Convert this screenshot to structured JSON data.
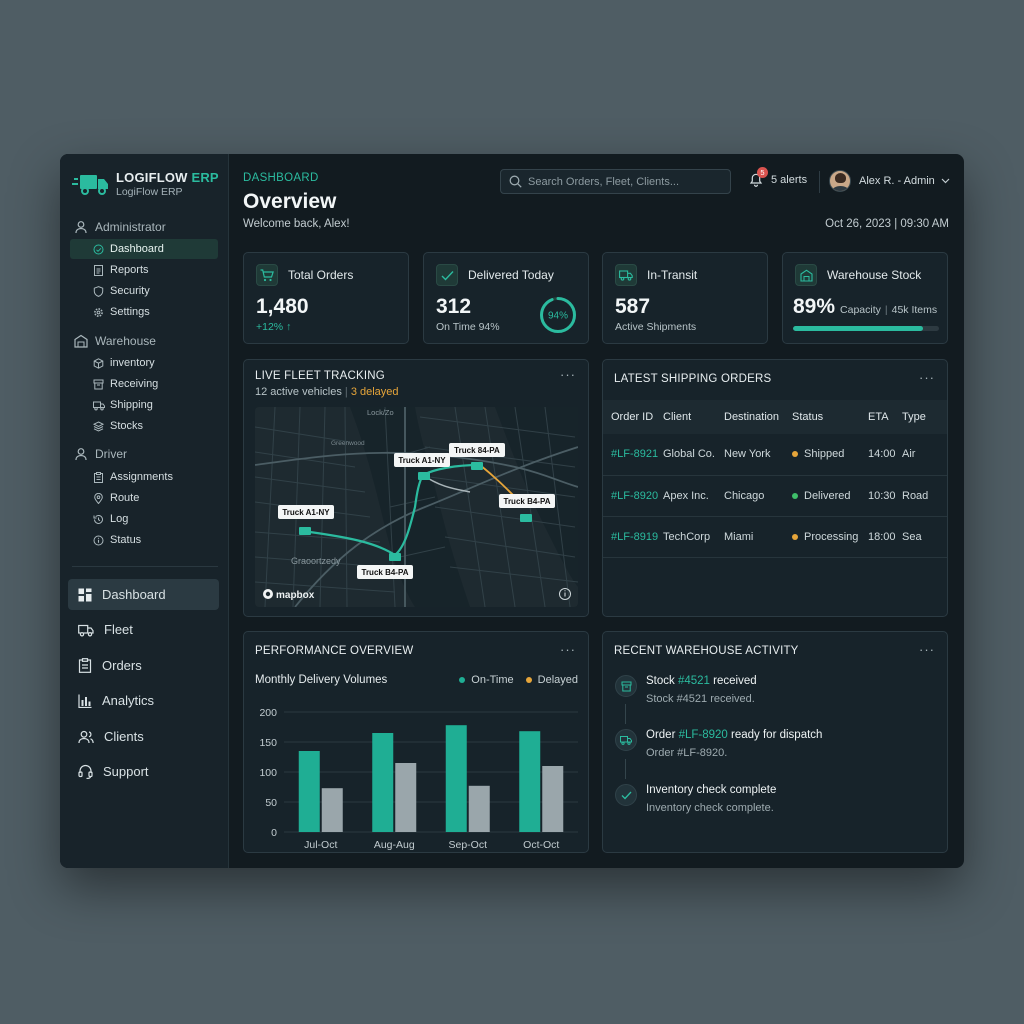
{
  "brand": {
    "title_main": "LOGIFLOW",
    "title_accent": "ERP",
    "subtitle": "LogiFlow ERP"
  },
  "sidebar": {
    "sections": [
      {
        "label": "Administrator",
        "icon": "user-icon",
        "items": [
          {
            "label": "Dashboard",
            "icon": "gauge-icon",
            "active": true
          },
          {
            "label": "Reports",
            "icon": "report-icon"
          },
          {
            "label": "Security",
            "icon": "shield-icon"
          },
          {
            "label": "Settings",
            "icon": "gear-icon"
          }
        ]
      },
      {
        "label": "Warehouse",
        "icon": "warehouse-icon",
        "items": [
          {
            "label": "inventory",
            "icon": "box-icon"
          },
          {
            "label": "Receiving",
            "icon": "receive-icon"
          },
          {
            "label": "Shipping",
            "icon": "truck-icon"
          },
          {
            "label": "Stocks",
            "icon": "stack-icon"
          }
        ]
      },
      {
        "label": "Driver",
        "icon": "driver-icon",
        "items": [
          {
            "label": "Assignments",
            "icon": "clipboard-icon"
          },
          {
            "label": "Route",
            "icon": "pin-icon"
          },
          {
            "label": "Log",
            "icon": "history-icon"
          },
          {
            "label": "Status",
            "icon": "info-icon"
          }
        ]
      }
    ],
    "main_nav": [
      {
        "label": "Dashboard",
        "icon": "grid-icon",
        "active": true
      },
      {
        "label": "Fleet",
        "icon": "truck-icon"
      },
      {
        "label": "Orders",
        "icon": "clipboard-icon"
      },
      {
        "label": "Analytics",
        "icon": "bar-chart-icon"
      },
      {
        "label": "Clients",
        "icon": "users-icon"
      },
      {
        "label": "Support",
        "icon": "headset-icon"
      }
    ]
  },
  "header": {
    "breadcrumb": "DASHBOARD",
    "title": "Overview",
    "welcome": "Welcome back, Alex!",
    "datetime": "Oct 26, 2023 | 09:30 AM",
    "search_placeholder": "Search Orders, Fleet, Clients...",
    "alerts_count": "5",
    "alerts_label": "5 alerts",
    "user_label": "Alex R. - Admin"
  },
  "kpis": {
    "total_orders": {
      "label": "Total Orders",
      "value": "1,480",
      "sub": "+12% ↑"
    },
    "delivered_today": {
      "label": "Delivered Today",
      "value": "312",
      "sub": "On Time 94%",
      "ring_label": "94%",
      "ring_fraction": 0.94
    },
    "in_transit": {
      "label": "In-Transit",
      "value": "587",
      "sub": "Active Shipments"
    },
    "warehouse_stock": {
      "label": "Warehouse Stock",
      "value": "89%",
      "capacity_label": "Capacity",
      "items": "45k Items",
      "fill_fraction": 0.89
    }
  },
  "fleet": {
    "title": "LIVE FLEET TRACKING",
    "subtitle_active": "12 active vehicles",
    "subtitle_delayed": "3 delayed",
    "truck_labels": [
      "Truck A1-NY",
      "Truck B4-PA",
      "Truck A1-NY",
      "Truck 84-PA",
      "Truck B4-PA"
    ],
    "street_labels": [
      "Lock/Zo",
      "Greenwood",
      "Graoortzedy"
    ],
    "attribution": "mapbox",
    "menu": "···"
  },
  "orders": {
    "title": "LATEST SHIPPING ORDERS",
    "menu": "···",
    "columns": [
      "Order ID",
      "Client",
      "Destination",
      "Status",
      "ETA",
      "Type"
    ],
    "rows": [
      {
        "id": "#LF-8921",
        "client": "Global Co.",
        "destination": "New York",
        "status": "Shipped",
        "status_color": "#e6a53a",
        "eta": "14:00",
        "type": "Air"
      },
      {
        "id": "#LF-8920",
        "client": "Apex Inc.",
        "destination": "Chicago",
        "status": "Delivered",
        "status_color": "#3fbf6a",
        "eta": "10:30",
        "type": "Road"
      },
      {
        "id": "#LF-8919",
        "client": "TechCorp",
        "destination": "Miami",
        "status": "Processing",
        "status_color": "#e6a53a",
        "eta": "18:00",
        "type": "Sea"
      }
    ]
  },
  "performance": {
    "title": "PERFORMANCE OVERVIEW",
    "menu": "···",
    "chart_title": "Monthly Delivery Volumes"
  },
  "chart_data": {
    "type": "bar",
    "title": "Monthly Delivery Volumes",
    "categories": [
      "Jul-Oct",
      "Aug-Aug",
      "Sep-Oct",
      "Oct-Oct"
    ],
    "series": [
      {
        "name": "On-Time",
        "color": "#1fae94",
        "values": [
          135,
          165,
          178,
          168
        ]
      },
      {
        "name": "Delayed",
        "color": "#9aa6ab",
        "values": [
          73,
          115,
          77,
          110
        ]
      }
    ],
    "yticks": [
      0,
      50,
      100,
      150,
      200
    ],
    "ylim": [
      0,
      200
    ],
    "grid": true,
    "legend": "top-right"
  },
  "activity": {
    "title": "RECENT WAREHOUSE ACTIVITY",
    "menu": "···",
    "items": [
      {
        "pre": "Stock ",
        "hl": "#4521",
        "post": " received",
        "sub": "Stock #4521 received.",
        "icon": "box-icon"
      },
      {
        "pre": "Order ",
        "hl": "#LF-8920",
        "post": " ready for dispatch",
        "sub": "Order #LF-8920.",
        "icon": "truck-icon"
      },
      {
        "pre": "Inventory check complete",
        "hl": "",
        "post": "",
        "sub": "Inventory check complete.",
        "icon": "check-icon"
      }
    ]
  },
  "colors": {
    "accent": "#2bbb9f",
    "delayed": "#e6a53a",
    "background": "#121b20"
  }
}
